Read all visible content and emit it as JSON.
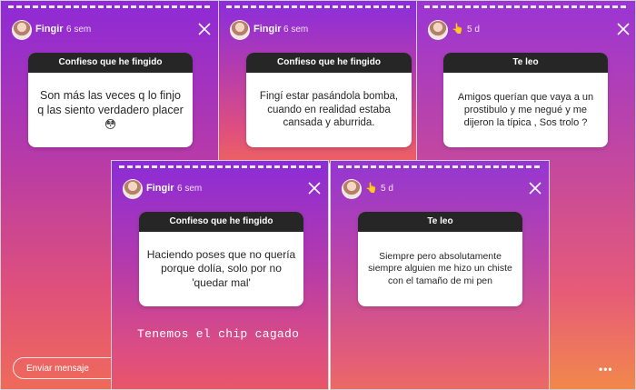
{
  "user": {
    "name": "Fingir"
  },
  "panels": [
    {
      "time": "6 sem",
      "header": "Confieso que he fingido",
      "body": "Son más las veces  q lo finjo q las siento verdadero placer 😳"
    },
    {
      "time": "6 sem",
      "header": "Confieso que he fingido",
      "body": "Fingí estar pasándola bomba, cuando en realidad estaba cansada y aburrida."
    },
    {
      "time": "5 d",
      "emoji": "👆",
      "header": "Te leo",
      "body": "Amigos querían que vaya a un prostibulo y me negué y me dijeron la típica , Sos trolo ?"
    },
    {
      "time": "6 sem",
      "header": "Confieso que he fingido",
      "body": "Haciendo poses que no quería porque dolía, solo por no 'quedar mal'",
      "caption": "Tenemos el chip cagado"
    },
    {
      "time": "5 d",
      "emoji": "👆",
      "header": "Te leo",
      "body": "Siempre pero absolutamente siempre alguien me hizo un chiste con el tamaño de mi pen"
    }
  ],
  "reply": {
    "placeholder": "Enviar mensaje",
    "more": "•••"
  },
  "icons": {
    "close": "close-icon",
    "avatar": "avatar",
    "more": "more-dots-icon",
    "emoji": "pointing-hand-emoji"
  },
  "colors": {
    "card_header": "#262626",
    "gradient_top": "#8e2ad6",
    "gradient_bottom": "#ef6a5a"
  }
}
